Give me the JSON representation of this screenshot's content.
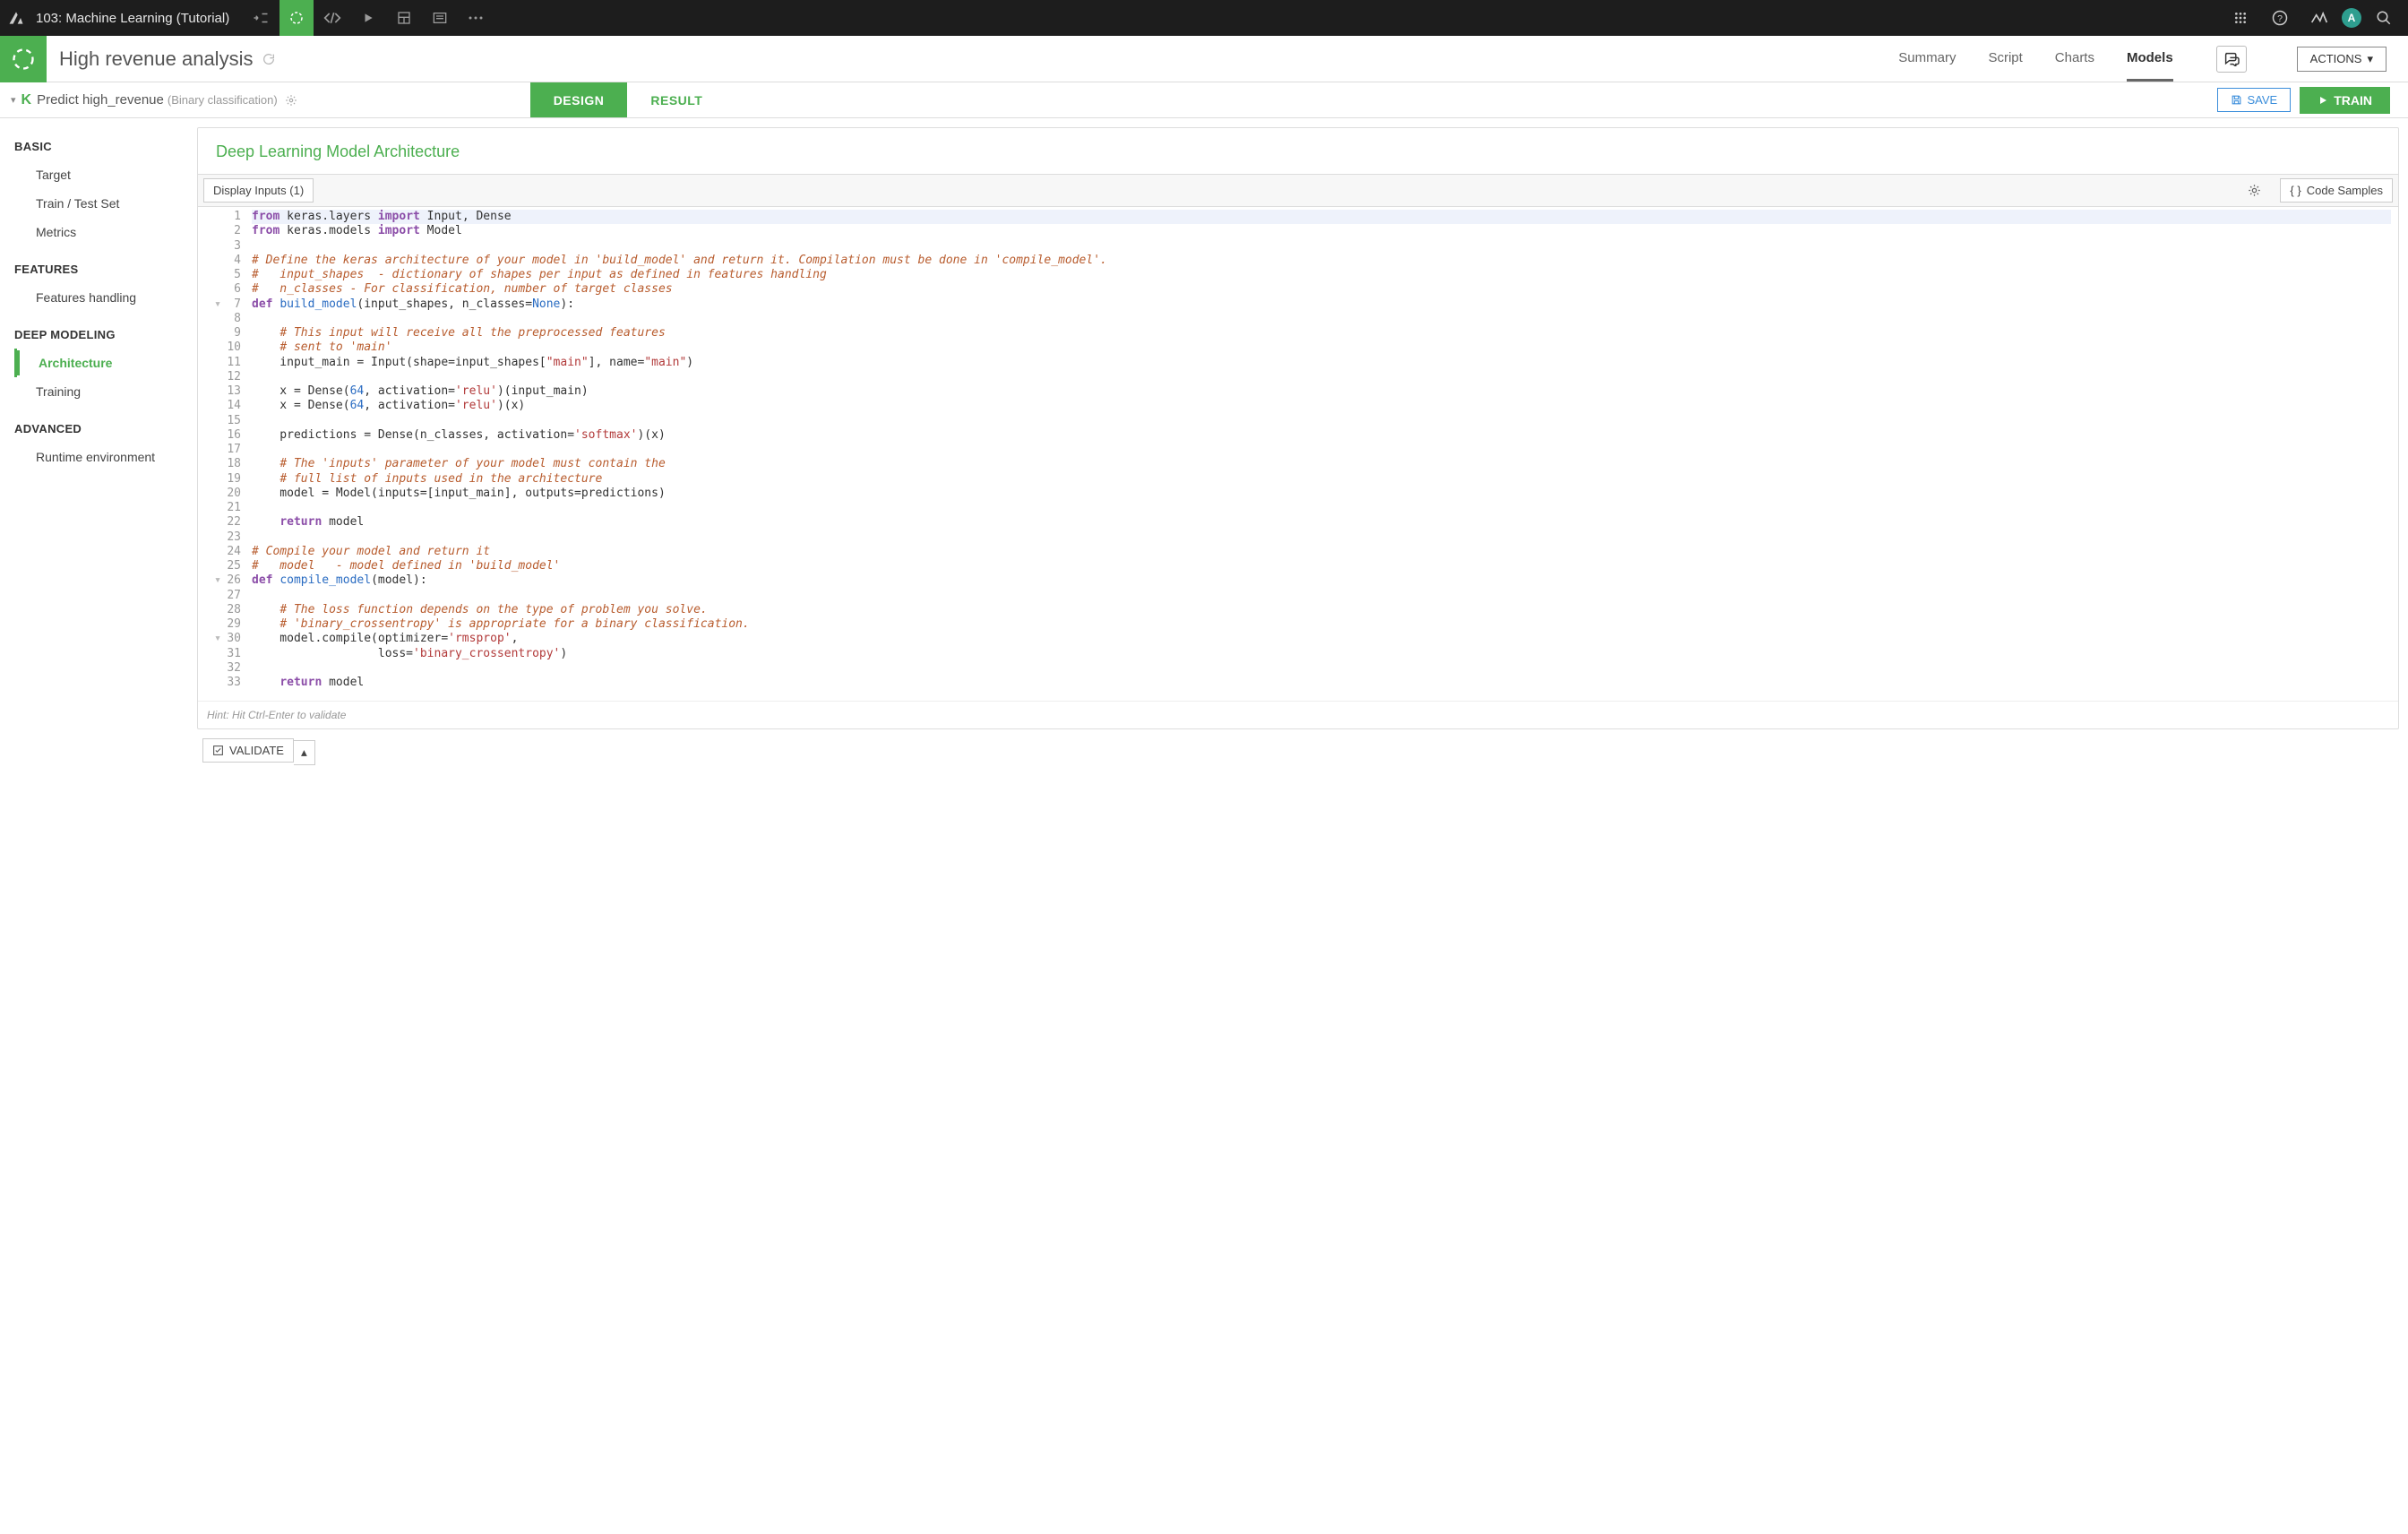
{
  "topbar": {
    "project": "103: Machine Learning (Tutorial)",
    "avatar_initial": "A"
  },
  "subheader": {
    "analysis_title": "High revenue analysis",
    "tabs": [
      "Summary",
      "Script",
      "Charts",
      "Models"
    ],
    "active_tab": "Models",
    "actions_label": "ACTIONS"
  },
  "row3": {
    "predict_label": "Predict high_revenue",
    "predict_sub": "(Binary classification)",
    "design_label": "DESIGN",
    "result_label": "RESULT",
    "save_label": "SAVE",
    "train_label": "TRAIN"
  },
  "sidebar": {
    "groups": [
      {
        "head": "BASIC",
        "items": [
          "Target",
          "Train / Test Set",
          "Metrics"
        ]
      },
      {
        "head": "FEATURES",
        "items": [
          "Features handling"
        ]
      },
      {
        "head": "DEEP MODELING",
        "items": [
          "Architecture",
          "Training"
        ]
      },
      {
        "head": "ADVANCED",
        "items": [
          "Runtime environment"
        ]
      }
    ],
    "active": "Architecture"
  },
  "panel": {
    "title": "Deep Learning Model Architecture",
    "display_inputs": "Display Inputs (1)",
    "code_samples": "Code Samples",
    "hint": "Hint: Hit Ctrl-Enter to validate",
    "validate": "VALIDATE"
  },
  "code": {
    "line_count": 33,
    "fold_markers": {
      "7": "▾",
      "26": "▾",
      "30": "▾"
    },
    "lines": [
      [
        [
          "kw",
          "from"
        ],
        [
          "nm",
          " keras.layers "
        ],
        [
          "kw",
          "import"
        ],
        [
          "nm",
          " Input, Dense"
        ]
      ],
      [
        [
          "kw",
          "from"
        ],
        [
          "nm",
          " keras.models "
        ],
        [
          "kw",
          "import"
        ],
        [
          "nm",
          " Model"
        ]
      ],
      [],
      [
        [
          "cm",
          "# Define the keras architecture of your model in 'build_model' and return it. Compilation must be done in 'compile_model'."
        ]
      ],
      [
        [
          "cm",
          "#   input_shapes  - dictionary of shapes per input as defined in features handling"
        ]
      ],
      [
        [
          "cm",
          "#   n_classes - For classification, number of target classes"
        ]
      ],
      [
        [
          "kw",
          "def "
        ],
        [
          "fn",
          "build_model"
        ],
        [
          "nm",
          "(input_shapes, n_classes="
        ],
        [
          "bi",
          "None"
        ],
        [
          "nm",
          "):"
        ]
      ],
      [],
      [
        [
          "nm",
          "    "
        ],
        [
          "cm",
          "# This input will receive all the preprocessed features"
        ]
      ],
      [
        [
          "nm",
          "    "
        ],
        [
          "cm",
          "# sent to 'main'"
        ]
      ],
      [
        [
          "nm",
          "    input_main = Input(shape=input_shapes["
        ],
        [
          "str",
          "\"main\""
        ],
        [
          "nm",
          "], name="
        ],
        [
          "str",
          "\"main\""
        ],
        [
          "nm",
          ")"
        ]
      ],
      [],
      [
        [
          "nm",
          "    x = Dense("
        ],
        [
          "num",
          "64"
        ],
        [
          "nm",
          ", activation="
        ],
        [
          "str",
          "'relu'"
        ],
        [
          "nm",
          ")(input_main)"
        ]
      ],
      [
        [
          "nm",
          "    x = Dense("
        ],
        [
          "num",
          "64"
        ],
        [
          "nm",
          ", activation="
        ],
        [
          "str",
          "'relu'"
        ],
        [
          "nm",
          ")(x)"
        ]
      ],
      [],
      [
        [
          "nm",
          "    predictions = Dense(n_classes, activation="
        ],
        [
          "str",
          "'softmax'"
        ],
        [
          "nm",
          ")(x)"
        ]
      ],
      [],
      [
        [
          "nm",
          "    "
        ],
        [
          "cm",
          "# The 'inputs' parameter of your model must contain the"
        ]
      ],
      [
        [
          "nm",
          "    "
        ],
        [
          "cm",
          "# full list of inputs used in the architecture"
        ]
      ],
      [
        [
          "nm",
          "    model = Model(inputs=[input_main], outputs=predictions)"
        ]
      ],
      [],
      [
        [
          "nm",
          "    "
        ],
        [
          "kw",
          "return"
        ],
        [
          "nm",
          " model"
        ]
      ],
      [],
      [
        [
          "cm",
          "# Compile your model and return it"
        ]
      ],
      [
        [
          "cm",
          "#   model   - model defined in 'build_model'"
        ]
      ],
      [
        [
          "kw",
          "def "
        ],
        [
          "fn",
          "compile_model"
        ],
        [
          "nm",
          "(model):"
        ]
      ],
      [],
      [
        [
          "nm",
          "    "
        ],
        [
          "cm",
          "# The loss function depends on the type of problem you solve."
        ]
      ],
      [
        [
          "nm",
          "    "
        ],
        [
          "cm",
          "# 'binary_crossentropy' is appropriate for a binary classification."
        ]
      ],
      [
        [
          "nm",
          "    model.compile(optimizer="
        ],
        [
          "str",
          "'rmsprop'"
        ],
        [
          "nm",
          ","
        ]
      ],
      [
        [
          "nm",
          "                  loss="
        ],
        [
          "str",
          "'binary_crossentropy'"
        ],
        [
          "nm",
          ")"
        ]
      ],
      [],
      [
        [
          "nm",
          "    "
        ],
        [
          "kw",
          "return"
        ],
        [
          "nm",
          " model"
        ]
      ]
    ]
  }
}
